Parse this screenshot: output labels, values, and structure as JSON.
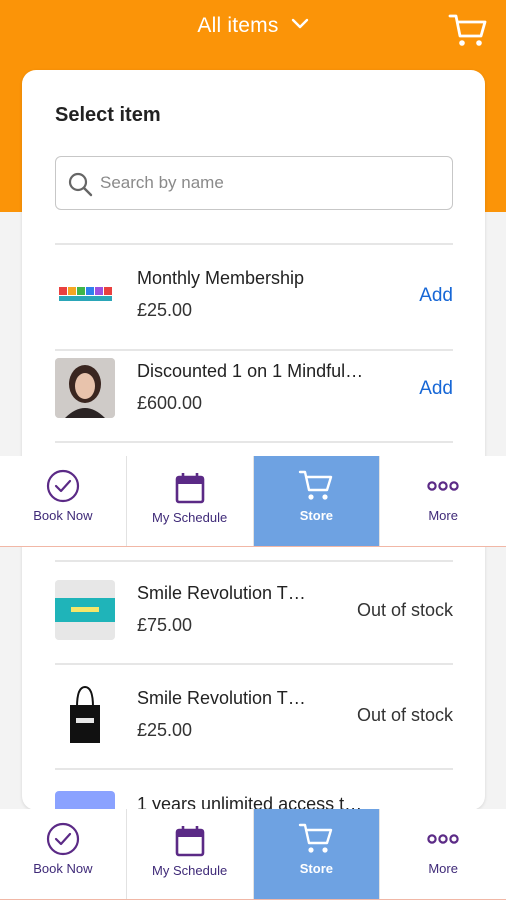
{
  "header": {
    "title": "All items",
    "background_color": "#fb9408",
    "cart_icon": "cart-icon"
  },
  "panel": {
    "title": "Select item",
    "search": {
      "placeholder": "Search by name",
      "value": ""
    }
  },
  "items": [
    {
      "name": "Monthly Membership",
      "price": "£25.00",
      "action": "Add",
      "thumb": "smile-revolution-logo"
    },
    {
      "name": "Discounted 1 on 1 Mindful…",
      "price": "£600.00",
      "action": "Add",
      "thumb": "portrait-photo"
    },
    {
      "name": "Smile Revolution T…",
      "price": "£75.00",
      "action": "Out of stock",
      "thumb": "teal-product-image"
    },
    {
      "name": "Smile Revolution T…",
      "price": "£25.00",
      "action": "Out of stock",
      "thumb": "tote-bag-image"
    },
    {
      "name": "1 years unlimited access t…",
      "price": "",
      "action": "",
      "thumb": "blue-product-image"
    }
  ],
  "tabbar": {
    "tabs": [
      {
        "label": "Book Now",
        "icon": "check-circle-icon",
        "active": false
      },
      {
        "label": "My Schedule",
        "icon": "calendar-icon",
        "active": false
      },
      {
        "label": "Store",
        "icon": "cart-icon",
        "active": true
      },
      {
        "label": "More",
        "icon": "more-dots-icon",
        "active": false
      }
    ]
  },
  "colors": {
    "accent": "#fb9408",
    "link": "#1767d6",
    "tab_active": "#6ea2e2",
    "tab_label": "#3f2a78"
  }
}
